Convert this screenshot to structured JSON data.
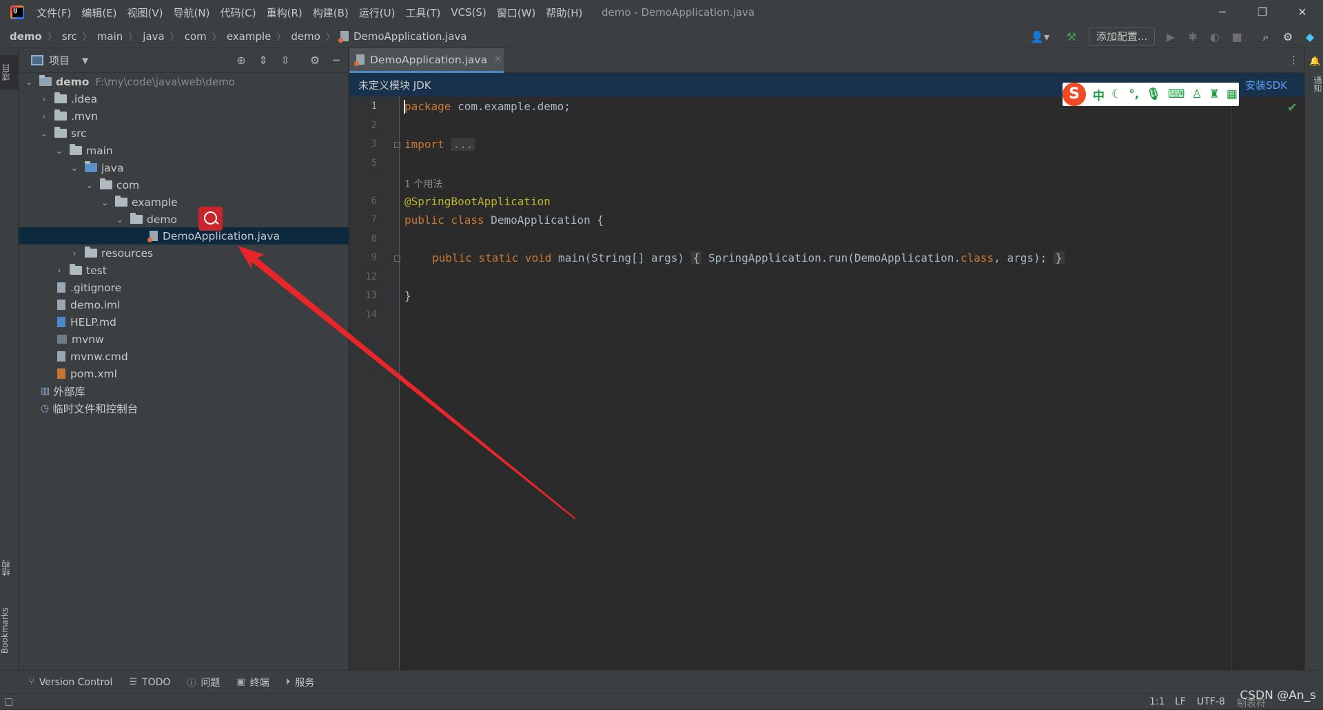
{
  "window": {
    "title": "demo - DemoApplication.java",
    "menu": [
      "文件(F)",
      "编辑(E)",
      "视图(V)",
      "导航(N)",
      "代码(C)",
      "重构(R)",
      "构建(B)",
      "运行(U)",
      "工具(T)",
      "VCS(S)",
      "窗口(W)",
      "帮助(H)"
    ]
  },
  "breadcrumb": [
    "demo",
    "src",
    "main",
    "java",
    "com",
    "example",
    "demo",
    "DemoApplication.java"
  ],
  "toolbar": {
    "add_config_label": "添加配置..."
  },
  "left_strip": {
    "project_tab": "项目",
    "structure_tab": "结构",
    "bookmarks_tab": "Bookmarks"
  },
  "right_strip": {
    "notifications_tab": "通知"
  },
  "project_panel": {
    "title": "项目",
    "root": {
      "name": "demo",
      "path": "F:\\my\\code\\java\\web\\demo"
    },
    "items": [
      ".idea",
      ".mvn",
      "src",
      "main",
      "java",
      "com",
      "example",
      "demo",
      "DemoApplication.java",
      "resources",
      "test",
      ".gitignore",
      "demo.iml",
      "HELP.md",
      "mvnw",
      "mvnw.cmd",
      "pom.xml",
      "外部库",
      "临时文件和控制台"
    ]
  },
  "editor": {
    "tab_label": "DemoApplication.java",
    "notice": "未定义模块 JDK",
    "install_sdk": "安装SDK",
    "line_numbers": [
      "1",
      "2",
      "3",
      "5",
      "6",
      "7",
      "8",
      "9",
      "12",
      "13",
      "14"
    ],
    "usage_hint": "1 个用法",
    "code": {
      "line1_kw": "package",
      "line1_rest": " com.example.demo;",
      "line3_kw": "import",
      "line3_fold": "...",
      "line6": "@SpringBootApplication",
      "line7_kw": "public class",
      "line7_rest": " DemoApplication {",
      "line9_kw": "public static void",
      "line9_rest": " main(String[] args) ",
      "line9_body1": " SpringApplication.run(DemoApplication.",
      "line9_class": "class",
      "line9_body2": ", args);",
      "line13": "}"
    }
  },
  "ime": {
    "logo": "S",
    "mode": "中"
  },
  "bottom_bar": [
    "Version Control",
    "TODO",
    "问题",
    "终端",
    "服务"
  ],
  "status_bar": {
    "position": "1:1",
    "line_sep": "LF",
    "encoding": "UTF-8",
    "indent": "制表符"
  },
  "watermark": "CSDN @An_s",
  "colors": {
    "accent": "#4a88c7",
    "keyword": "#cc7832",
    "annotation": "#bbb529",
    "arrow": "#e8262a"
  }
}
